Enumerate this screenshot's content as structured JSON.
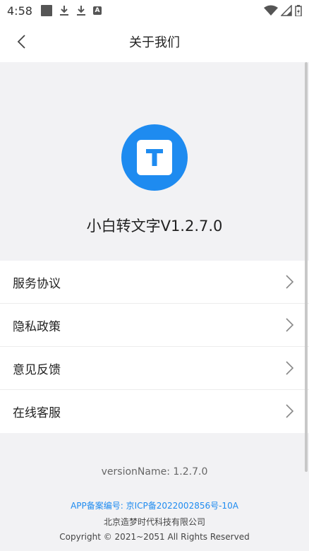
{
  "status_bar": {
    "time": "4:58",
    "left_icons": [
      "square-icon",
      "download-icon",
      "download-icon",
      "a-icon"
    ],
    "a_icon_label": "A",
    "right_icons": [
      "wifi-icon",
      "signal-icon",
      "battery-icon"
    ]
  },
  "nav": {
    "title": "关于我们",
    "back_icon": "chevron-left-icon"
  },
  "app": {
    "logo_icon": "t-logo-icon",
    "name": "小白转文字V1.2.7.0",
    "accent_color": "#1e8bf0"
  },
  "menu": {
    "items": [
      {
        "label": "服务协议",
        "icon": "chevron-right-icon"
      },
      {
        "label": "隐私政策",
        "icon": "chevron-right-icon"
      },
      {
        "label": "意见反馈",
        "icon": "chevron-right-icon"
      },
      {
        "label": "在线客服",
        "icon": "chevron-right-icon"
      }
    ]
  },
  "footer": {
    "version": "versionName: 1.2.7.0",
    "icp": "APP备案编号: 京ICP备2022002856号-10A",
    "company": "北京造梦时代科技有限公司",
    "copyright": "Copyright © 2021~2051 All Rights Reserved"
  }
}
